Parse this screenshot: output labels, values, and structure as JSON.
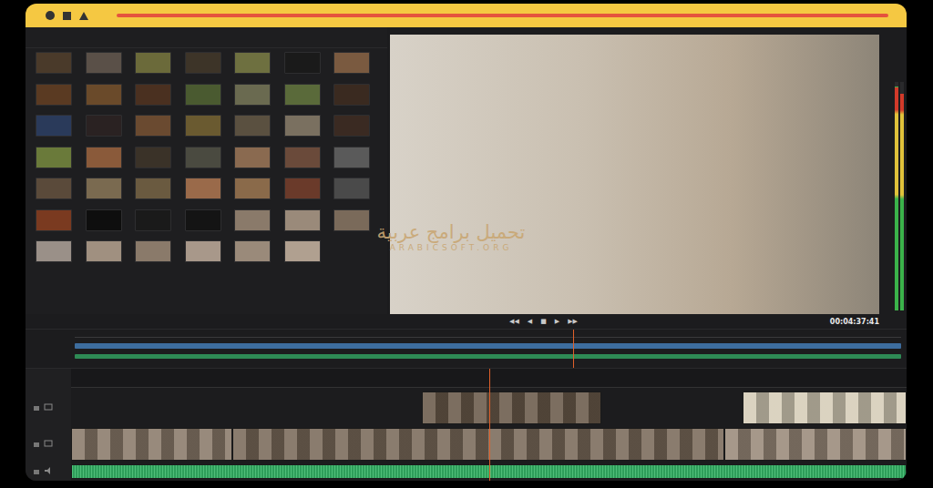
{
  "mediaPool": {
    "thumbnails": [
      {
        "color": "#4a3a2a"
      },
      {
        "color": "#5a5048"
      },
      {
        "color": "#6b6a3a"
      },
      {
        "color": "#3d3428"
      },
      {
        "color": "#6e7040"
      },
      {
        "color": "#1a1a1a"
      },
      {
        "color": "#7a5a40"
      },
      {
        "color": "#5a3a22"
      },
      {
        "color": "#6a4a2a"
      },
      {
        "color": "#4a3020"
      },
      {
        "color": "#4a5a30"
      },
      {
        "color": "#6a6a50"
      },
      {
        "color": "#5a6a3a"
      },
      {
        "color": "#3a2a20"
      },
      {
        "color": "#2a3a5a"
      },
      {
        "color": "#2a2222"
      },
      {
        "color": "#6a4a30"
      },
      {
        "color": "#6a5a30"
      },
      {
        "color": "#5a5040"
      },
      {
        "color": "#7a7060"
      },
      {
        "color": "#3a2a22"
      },
      {
        "color": "#6a7a3a"
      },
      {
        "color": "#8a5a3a"
      },
      {
        "color": "#3a3228"
      },
      {
        "color": "#4a4a40"
      },
      {
        "color": "#8a6a50"
      },
      {
        "color": "#6a4a3a"
      },
      {
        "color": "#5a5a5a"
      },
      {
        "color": "#5a4a3a"
      },
      {
        "color": "#7a6a50"
      },
      {
        "color": "#6a5a40"
      },
      {
        "color": "#9a6a4a"
      },
      {
        "color": "#8a6a4a"
      },
      {
        "color": "#6a3a2a"
      },
      {
        "color": "#4a4a4a"
      },
      {
        "color": "#7a3a20"
      },
      {
        "color": "#0e0e0e"
      },
      {
        "color": "#1a1a1a"
      },
      {
        "color": "#141414"
      },
      {
        "color": "#8a7a6a"
      },
      {
        "color": "#9a8a7a"
      },
      {
        "color": "#7a6a5a"
      },
      {
        "color": "#9a9088"
      },
      {
        "color": "#a09080"
      },
      {
        "color": "#8a7a6a"
      },
      {
        "color": "#a8988a"
      },
      {
        "color": "#9a8a7a"
      },
      {
        "color": "#b0a090"
      }
    ]
  },
  "viewer": {
    "timecode": "00:04:37:41",
    "transport": [
      "◀◀",
      "◀",
      "■",
      "▶",
      "▶▶"
    ]
  },
  "meter": {
    "channels": [
      {
        "level": 0.98
      },
      {
        "level": 0.95
      }
    ]
  },
  "miniTimeline": {
    "playhead": {
      "level": 0.6
    }
  },
  "timeline": {
    "playhead": {
      "level": 0.5
    },
    "tracks": [
      {
        "kind": "video",
        "clips": [
          {
            "start": 0.42,
            "end": 0.635,
            "color": "#6a5a4a"
          },
          {
            "start": 0.804,
            "end": 1,
            "color": "#d6cdb8"
          }
        ]
      },
      {
        "kind": "video",
        "clips": [
          {
            "start": 0,
            "end": 0.193,
            "color": "#8a7a6a"
          },
          {
            "start": 0.193,
            "end": 0.782,
            "color": "#7a6a5a"
          },
          {
            "start": 0.782,
            "end": 1,
            "color": "#9a8a7a"
          }
        ]
      },
      {
        "kind": "audio",
        "clips": [
          {
            "start": 0,
            "end": 1,
            "color": "#2e9e5a"
          }
        ]
      }
    ]
  },
  "watermark": {
    "arabic": "تحميل برامج عربية",
    "latin": "ARABICSOFT.ORG"
  }
}
